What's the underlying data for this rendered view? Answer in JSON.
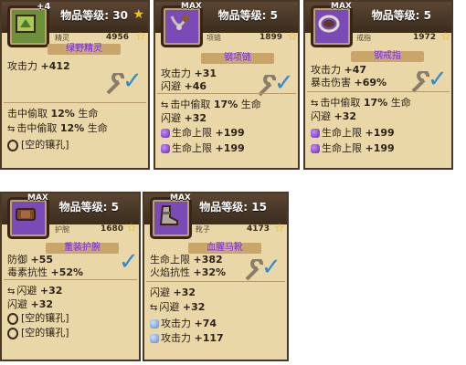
{
  "common": {
    "level_label": "物品等级:"
  },
  "cards": [
    {
      "badge": "+4",
      "level": "30",
      "type": "精灵",
      "price": "4956",
      "name": "绿野精灵",
      "main": [
        {
          "label": "攻击力",
          "value": "+412"
        }
      ],
      "sub": [
        {
          "label": "击中偷取",
          "value": "12%",
          "suffix": "生命"
        },
        {
          "label": "击中偷取",
          "value": "12%",
          "suffix": "生命"
        },
        {
          "label": "[空的镶孔]",
          "value": ""
        }
      ]
    },
    {
      "badge": "MAX",
      "level": "5",
      "type": "项链",
      "price": "1899",
      "name": "钢项链",
      "main": [
        {
          "label": "攻击力",
          "value": "+31"
        },
        {
          "label": "闪避",
          "value": "+46"
        }
      ],
      "sub": [
        {
          "label": "击中偷取",
          "value": "17%",
          "suffix": "生命"
        },
        {
          "label": "闪避",
          "value": "+32"
        },
        {
          "label": "生命上限",
          "value": "+199"
        },
        {
          "label": "生命上限",
          "value": "+199"
        }
      ]
    },
    {
      "badge": "MAX",
      "level": "5",
      "type": "戒指",
      "price": "1972",
      "name": "钢戒指",
      "main": [
        {
          "label": "攻击力",
          "value": "+47"
        },
        {
          "label": "暴击伤害",
          "value": "+69%"
        }
      ],
      "sub": [
        {
          "label": "击中偷取",
          "value": "17%",
          "suffix": "生命"
        },
        {
          "label": "闪避",
          "value": "+32"
        },
        {
          "label": "生命上限",
          "value": "+199"
        },
        {
          "label": "生命上限",
          "value": "+199"
        }
      ]
    },
    {
      "badge": "MAX",
      "level": "5",
      "type": "护腕",
      "price": "1680",
      "name": "重装护腕",
      "main": [
        {
          "label": "防御",
          "value": "+55"
        },
        {
          "label": "毒素抗性",
          "value": "+52%"
        }
      ],
      "sub": [
        {
          "label": "闪避",
          "value": "+32"
        },
        {
          "label": "闪避",
          "value": "+32"
        },
        {
          "label": "[空的镶孔]",
          "value": ""
        },
        {
          "label": "[空的镶孔]",
          "value": ""
        }
      ]
    },
    {
      "badge": "MAX",
      "level": "15",
      "type": "靴子",
      "price": "4173",
      "name": "血腥马靴",
      "main": [
        {
          "label": "生命上限",
          "value": "+382"
        },
        {
          "label": "火焰抗性",
          "value": "+32%"
        }
      ],
      "sub": [
        {
          "label": "闪避",
          "value": "+32"
        },
        {
          "label": "闪避",
          "value": "+32"
        },
        {
          "label": "攻击力",
          "value": "+74"
        },
        {
          "label": "攻击力",
          "value": "+117"
        }
      ]
    }
  ],
  "icons": {
    "star": "star-icon",
    "check": "equipped-check-icon",
    "swap": "reroll-swap-icon",
    "gem": "gem-icon",
    "socket": "empty-socket-icon"
  },
  "colors": {
    "card_bg": "#e9d7a8",
    "header_bg": "#3b2c1d",
    "name_purple": "#8a3fc3",
    "check_blue": "#2e8ad1",
    "star_gold": "#f2c21b"
  }
}
